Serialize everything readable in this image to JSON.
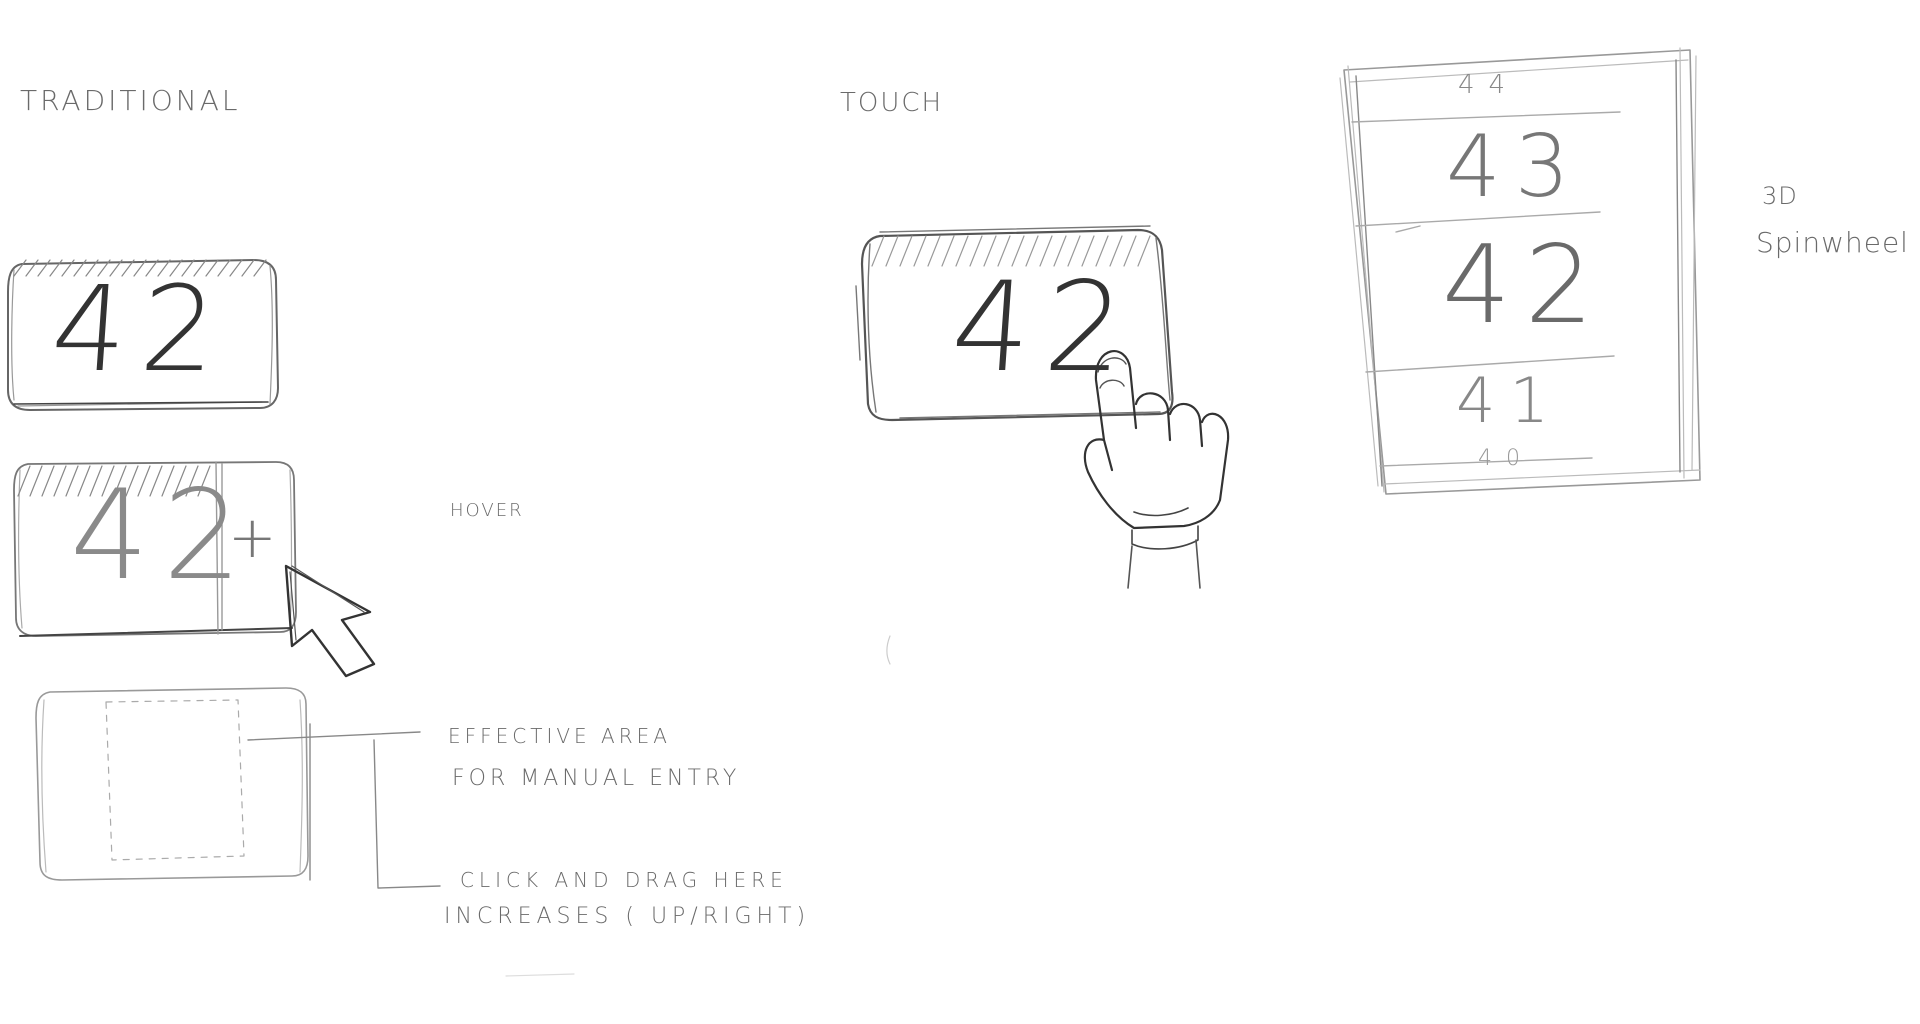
{
  "sections": {
    "traditional": {
      "title": "TRADITIONAL",
      "input_value": "42",
      "hover_value": "42",
      "plus_symbol": "+",
      "hover_label": "HOVER"
    },
    "annotations": {
      "manual_entry_line1": "EFFECTIVE AREA",
      "manual_entry_line2": "FOR MANUAL ENTRY",
      "drag_line1": "CLICK AND DRAG HERE",
      "drag_line2": "INCREASES ( UP/RIGHT)"
    },
    "touch": {
      "title": "TOUCH",
      "input_value": "42"
    },
    "spinwheel": {
      "label_line1": "3D",
      "label_line2": "Spinwheel",
      "values": [
        "44",
        "43",
        "42",
        "41",
        "40"
      ]
    }
  },
  "colors": {
    "paper": "#ffffff",
    "pencil_dark": "#333333",
    "pencil_light": "#9a9a9a"
  }
}
